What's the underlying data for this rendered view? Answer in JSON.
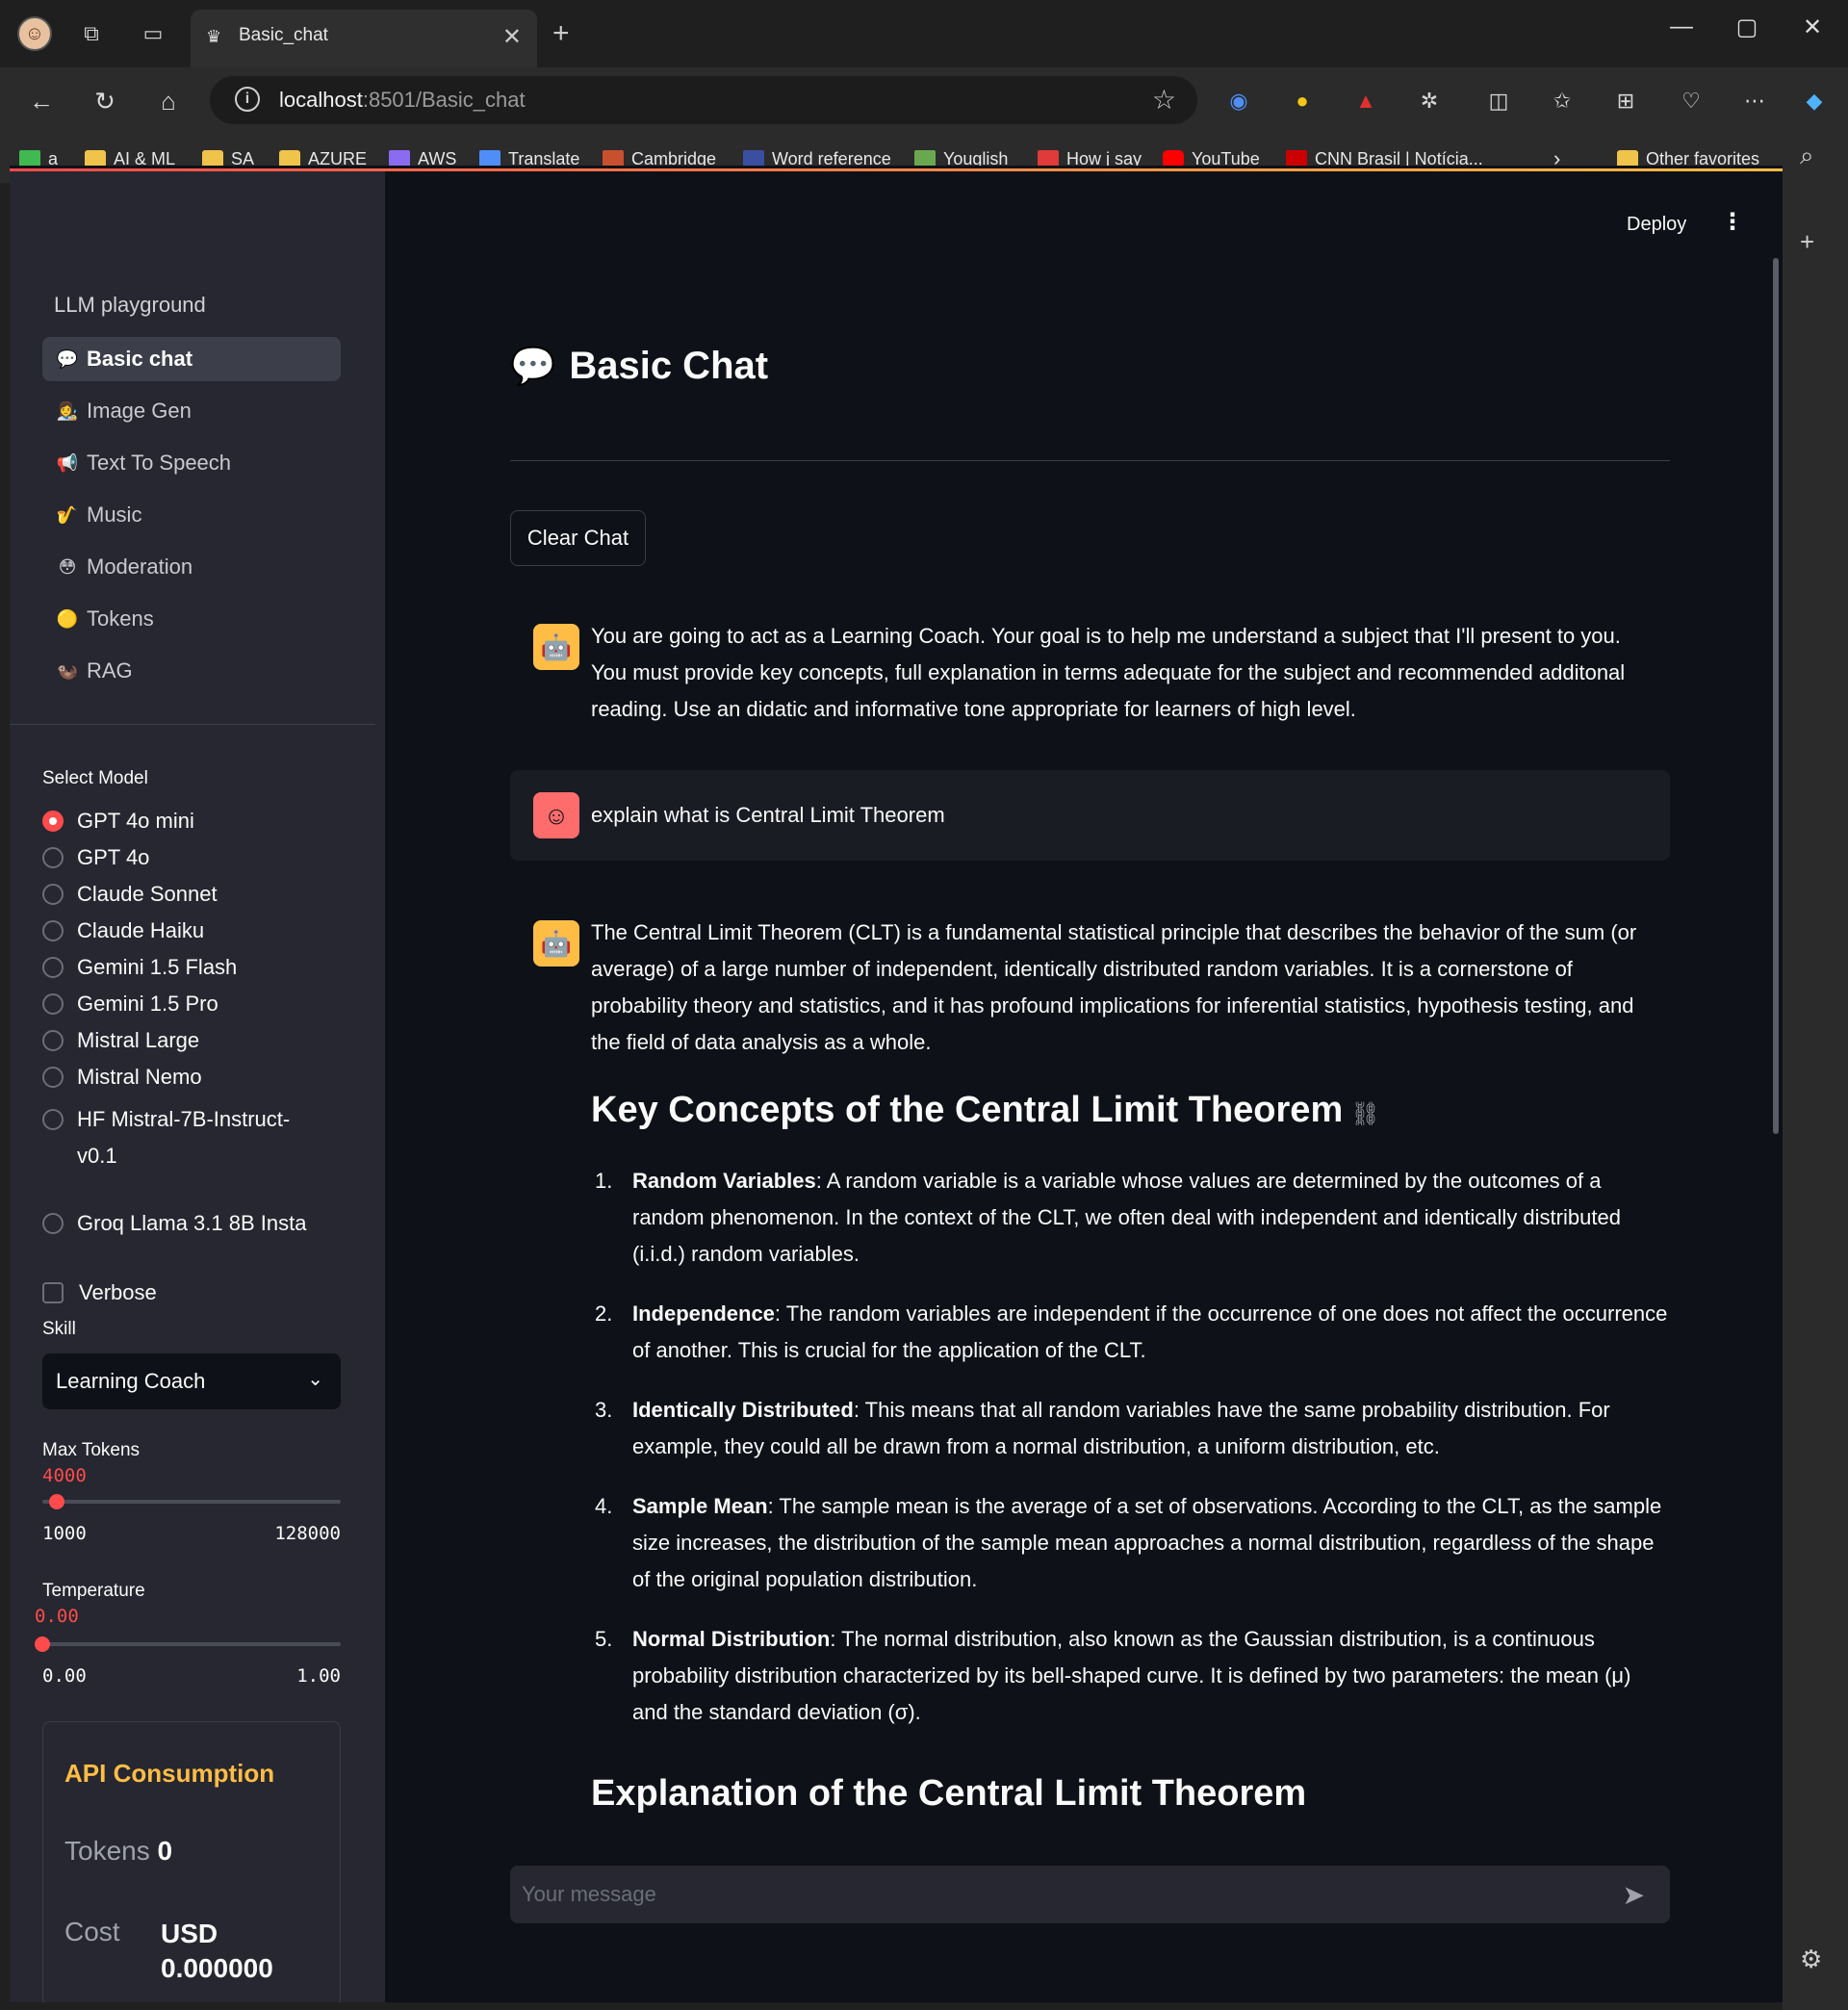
{
  "browser": {
    "tab_title": "Basic_chat",
    "url_host": "localhost",
    "url_path": ":8501/Basic_chat",
    "bookmarks": [
      {
        "label": "a",
        "icon": "green-square-icon"
      },
      {
        "label": "AI & ML",
        "icon": "folder-icon"
      },
      {
        "label": "SA",
        "icon": "folder-icon"
      },
      {
        "label": "AZURE",
        "icon": "folder-icon"
      },
      {
        "label": "AWS",
        "icon": "cube-icon"
      },
      {
        "label": "Translate",
        "icon": "translate-icon"
      },
      {
        "label": "Cambridge",
        "icon": "cambridge-icon"
      },
      {
        "label": "Word reference",
        "icon": "wr-icon"
      },
      {
        "label": "Youglish",
        "icon": "youglish-icon"
      },
      {
        "label": "How j say",
        "icon": "howjsay-icon"
      },
      {
        "label": "YouTube",
        "icon": "youtube-icon"
      },
      {
        "label": "CNN Brasil | Notícia...",
        "icon": "cnn-icon"
      }
    ],
    "other_favorites": "Other favorites"
  },
  "sidebar": {
    "title": "LLM playground",
    "nav": [
      {
        "label": "Basic chat",
        "emoji": "💬",
        "active": true
      },
      {
        "label": "Image Gen",
        "emoji": "👩‍🎨",
        "active": false
      },
      {
        "label": "Text To Speech",
        "emoji": "📢",
        "active": false
      },
      {
        "label": "Music",
        "emoji": "🎷",
        "active": false
      },
      {
        "label": "Moderation",
        "emoji": "😳",
        "active": false
      },
      {
        "label": "Tokens",
        "emoji": "🟡",
        "active": false
      },
      {
        "label": "RAG",
        "emoji": "🦦",
        "active": false
      }
    ],
    "select_model_label": "Select Model",
    "models": [
      {
        "label": "GPT 4o mini",
        "selected": true
      },
      {
        "label": "GPT 4o",
        "selected": false
      },
      {
        "label": "Claude Sonnet",
        "selected": false
      },
      {
        "label": "Claude Haiku",
        "selected": false
      },
      {
        "label": "Gemini 1.5 Flash",
        "selected": false
      },
      {
        "label": "Gemini 1.5 Pro",
        "selected": false
      },
      {
        "label": "Mistral Large",
        "selected": false
      },
      {
        "label": "Mistral Nemo",
        "selected": false
      },
      {
        "label": "HF Mistral-7B-Instruct-",
        "label2": "v0.1",
        "selected": false
      },
      {
        "label": "Groq Llama 3.1 8B Insta",
        "selected": false
      }
    ],
    "verbose_label": "Verbose",
    "verbose_checked": false,
    "skill_label": "Skill",
    "skill_value": "Learning Coach",
    "max_tokens": {
      "label": "Max Tokens",
      "value": "4000",
      "min": "1000",
      "max": "128000",
      "fraction": 0.024
    },
    "temperature": {
      "label": "Temperature",
      "value": "0.00",
      "min": "0.00",
      "max": "1.00",
      "fraction": 0.0
    },
    "api": {
      "title": "API Consumption",
      "tokens_label": "Tokens",
      "tokens_value": "0",
      "cost_label": "Cost",
      "cost_currency": "USD",
      "cost_value": "0.000000"
    }
  },
  "main": {
    "deploy_label": "Deploy",
    "title_emoji": "💬",
    "title": "Basic Chat",
    "clear_button": "Clear Chat",
    "system_message": "You are going to act as a Learning Coach. Your goal is to help me understand a subject that I'll present to you. You must provide key concepts, full explanation in terms adequate for the subject and recommended additonal reading. Use an didatic and informative tone appropriate for learners of high level.",
    "user_message": "explain what is Central Limit Theorem",
    "assistant_intro": "The Central Limit Theorem (CLT) is a fundamental statistical principle that describes the behavior of the sum (or average) of a large number of independent, identically distributed random variables. It is a cornerstone of probability theory and statistics, and it has profound implications for inferential statistics, hypothesis testing, and the field of data analysis as a whole.",
    "heading1": "Key Concepts of the Central Limit Theorem",
    "concepts": [
      {
        "num": "1.",
        "term": "Random Variables",
        "text": ": A random variable is a variable whose values are determined by the outcomes of a random phenomenon. In the context of the CLT, we often deal with independent and identically distributed (i.i.d.) random variables."
      },
      {
        "num": "2.",
        "term": "Independence",
        "text": ": The random variables are independent if the occurrence of one does not affect the occurrence of another. This is crucial for the application of the CLT."
      },
      {
        "num": "3.",
        "term": "Identically Distributed",
        "text": ": This means that all random variables have the same probability distribution. For example, they could all be drawn from a normal distribution, a uniform distribution, etc."
      },
      {
        "num": "4.",
        "term": "Sample Mean",
        "text": ": The sample mean is the average of a set of observations. According to the CLT, as the sample size increases, the distribution of the sample mean approaches a normal distribution, regardless of the shape of the original population distribution."
      },
      {
        "num": "5.",
        "term": "Normal Distribution",
        "text": ": The normal distribution, also known as the Gaussian distribution, is a continuous probability distribution characterized by its bell-shaped curve. It is defined by two parameters: the mean (μ) and the standard deviation (σ)."
      }
    ],
    "heading2": "Explanation of the Central Limit Theorem",
    "input_placeholder": "Your message"
  }
}
